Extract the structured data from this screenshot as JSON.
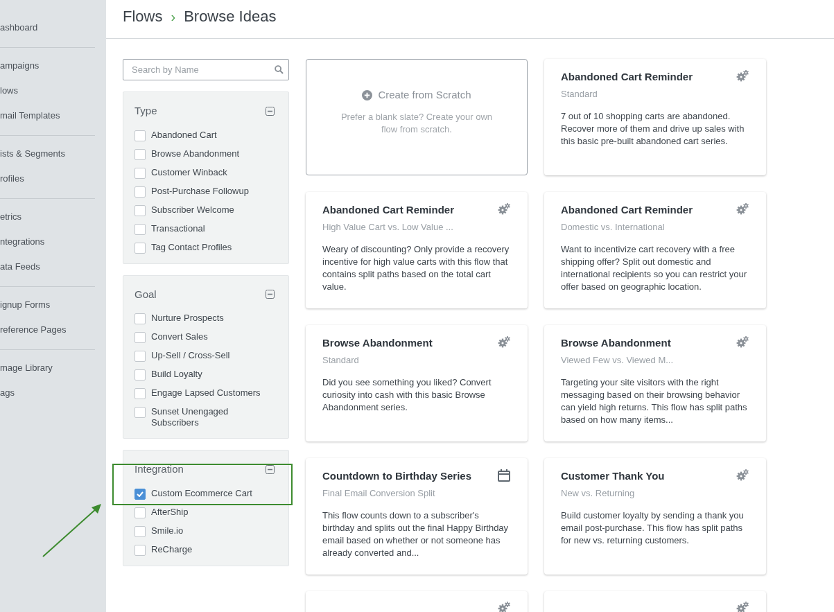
{
  "sidebar": {
    "groups": [
      {
        "items": [
          "ashboard"
        ]
      },
      {
        "items": [
          "ampaigns",
          "lows",
          "mail Templates"
        ]
      },
      {
        "items": [
          "ists & Segments",
          "rofiles"
        ]
      },
      {
        "items": [
          "etrics",
          "ntegrations",
          "ata Feeds"
        ]
      },
      {
        "items": [
          "ignup Forms",
          "reference Pages"
        ]
      },
      {
        "items": [
          "mage Library",
          "ags"
        ]
      }
    ]
  },
  "breadcrumb": [
    "Flows",
    "Browse Ideas"
  ],
  "breadcrumb_separator": "›",
  "search": {
    "placeholder": "Search by Name"
  },
  "filters": [
    {
      "title": "Type",
      "options": [
        {
          "label": "Abandoned Cart",
          "checked": false
        },
        {
          "label": "Browse Abandonment",
          "checked": false
        },
        {
          "label": "Customer Winback",
          "checked": false
        },
        {
          "label": "Post-Purchase Followup",
          "checked": false
        },
        {
          "label": "Subscriber Welcome",
          "checked": false
        },
        {
          "label": "Transactional",
          "checked": false
        },
        {
          "label": "Tag Contact Profiles",
          "checked": false
        }
      ]
    },
    {
      "title": "Goal",
      "options": [
        {
          "label": "Nurture Prospects",
          "checked": false
        },
        {
          "label": "Convert Sales",
          "checked": false
        },
        {
          "label": "Up-Sell / Cross-Sell",
          "checked": false
        },
        {
          "label": "Build Loyalty",
          "checked": false
        },
        {
          "label": "Engage Lapsed Customers",
          "checked": false
        },
        {
          "label": "Sunset Unengaged Subscribers",
          "checked": false
        }
      ]
    },
    {
      "title": "Integration",
      "highlighted": true,
      "options": [
        {
          "label": "Custom Ecommerce Cart",
          "checked": true
        },
        {
          "label": "AfterShip",
          "checked": false
        },
        {
          "label": "Smile.io",
          "checked": false
        },
        {
          "label": "ReCharge",
          "checked": false
        }
      ]
    }
  ],
  "cards": [
    {
      "kind": "scratch",
      "title": "Create from Scratch",
      "description": "Prefer a blank slate? Create your own flow from scratch."
    },
    {
      "kind": "flow",
      "title": "Abandoned Cart Reminder",
      "subtitle": "Standard",
      "description": "7 out of 10 shopping carts are abandoned. Recover more of them and drive up sales with this basic pre-built abandoned cart series."
    },
    {
      "kind": "flow",
      "title": "Abandoned Cart Reminder",
      "subtitle": "High Value Cart vs. Low Value ...",
      "description": "Weary of discounting? Only provide a recovery incentive for high value carts with this flow that contains split paths based on the total cart value."
    },
    {
      "kind": "flow",
      "title": "Abandoned Cart Reminder",
      "subtitle": "Domestic vs. International",
      "description": "Want to incentivize cart recovery with a free shipping offer? Split out domestic and international recipients so you can restrict your offer based on geographic location."
    },
    {
      "kind": "flow",
      "title": "Browse Abandonment",
      "subtitle": "Standard",
      "description": "Did you see something you liked? Convert curiosity into cash with this basic Browse Abandonment series."
    },
    {
      "kind": "flow",
      "title": "Browse Abandonment",
      "subtitle": "Viewed Few vs. Viewed M...",
      "description": "Targeting your site visitors with the right messaging based on their browsing behavior can yield high returns. This flow has split paths based on how many items..."
    },
    {
      "kind": "dated",
      "title": "Countdown to Birthday Series",
      "subtitle": "Final Email Conversion Split",
      "description": "This flow counts down to a subscriber's birthday and splits out the final Happy Birthday email based on whether or not someone has already converted and..."
    },
    {
      "kind": "flow",
      "title": "Customer Thank You",
      "subtitle": "New vs. Returning",
      "description": "Build customer loyalty by sending a thank you email post-purchase. This flow has split paths for new vs. returning customers."
    },
    {
      "kind": "partial"
    },
    {
      "kind": "partial"
    }
  ]
}
